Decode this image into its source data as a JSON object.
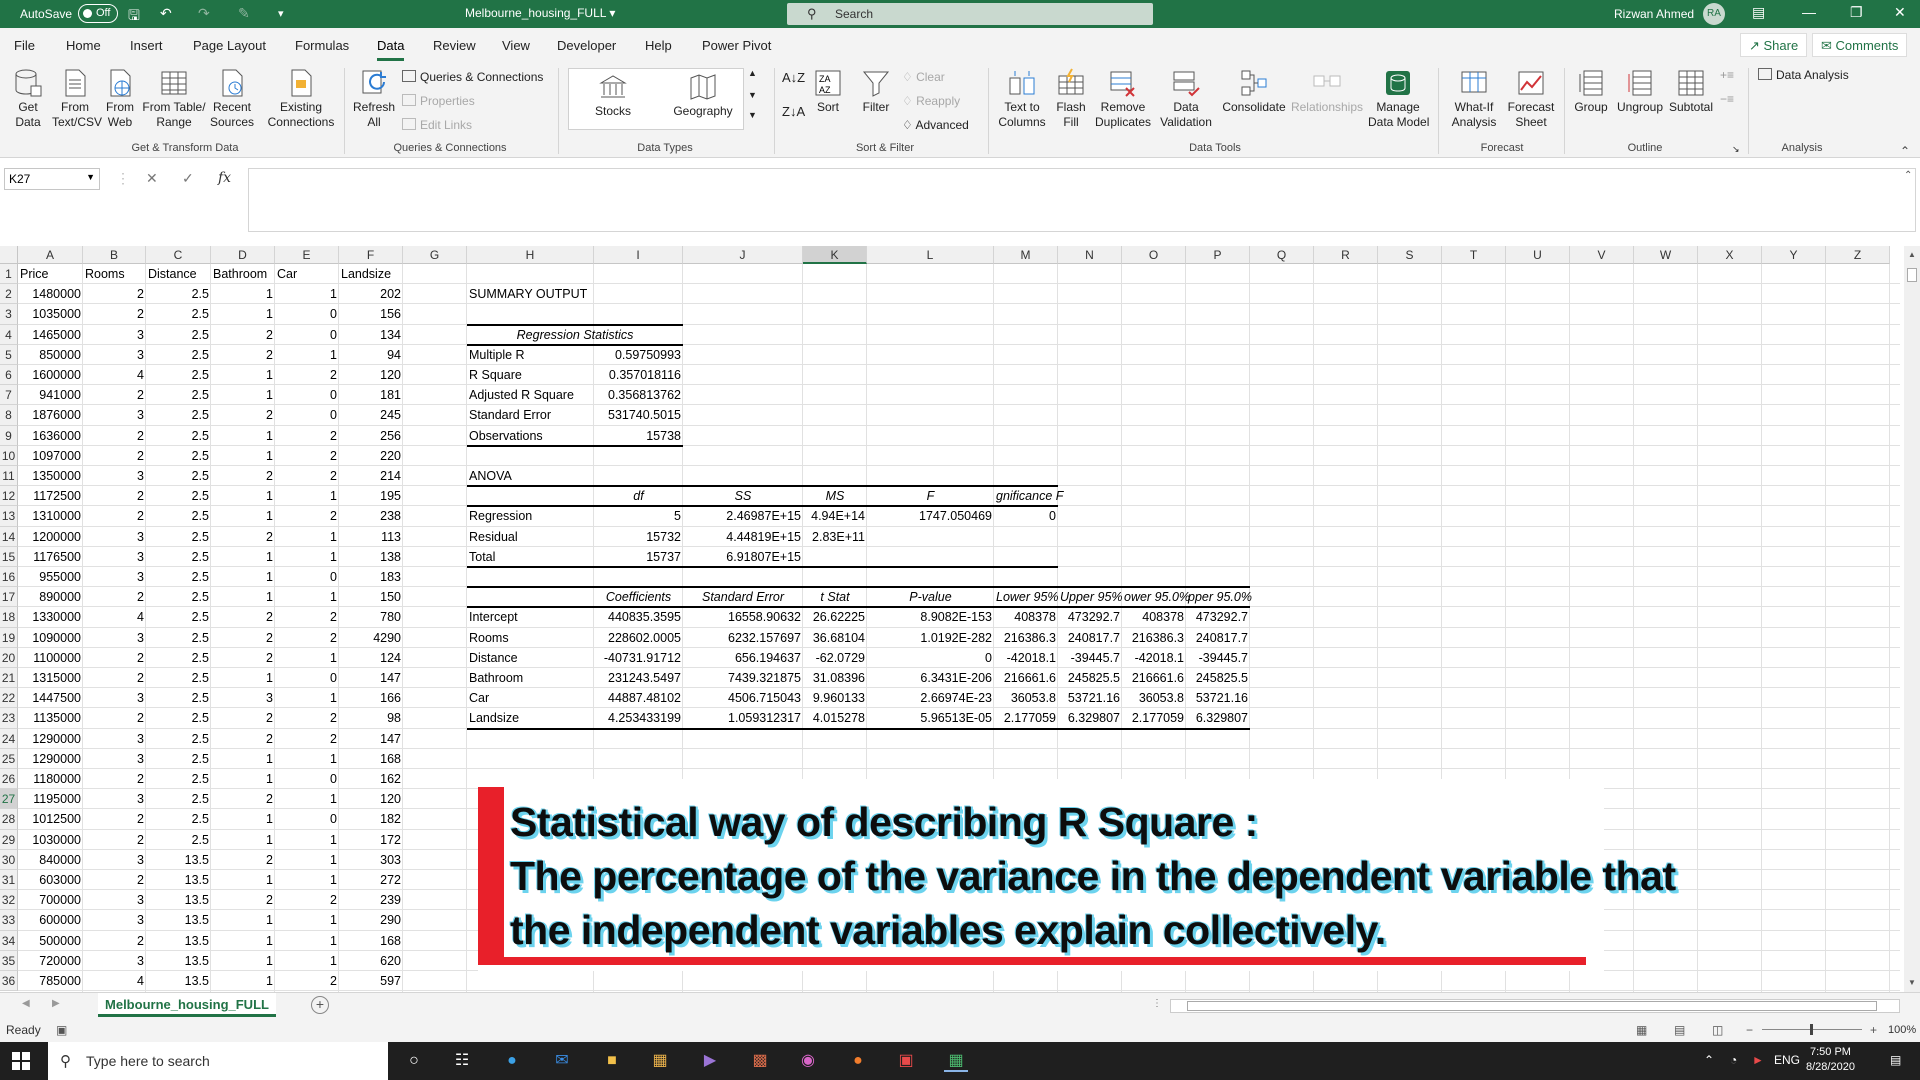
{
  "titlebar": {
    "autosave_label": "AutoSave",
    "autosave_state": "Off",
    "doc_title": "Melbourne_housing_FULL",
    "search_placeholder": "Search",
    "user_name": "Rizwan Ahmed",
    "user_initials": "RA"
  },
  "menu": {
    "tabs": [
      "File",
      "Home",
      "Insert",
      "Page Layout",
      "Formulas",
      "Data",
      "Review",
      "View",
      "Developer",
      "Help",
      "Power Pivot"
    ],
    "active": "Data",
    "share_label": "Share",
    "comments_label": "Comments"
  },
  "ribbon": {
    "get_data": "Get\nData",
    "from_text_csv": "From\nText/CSV",
    "from_web": "From\nWeb",
    "from_table_range": "From Table/\nRange",
    "recent_sources": "Recent\nSources",
    "existing_connections": "Existing\nConnections",
    "group_get_transform": "Get & Transform Data",
    "refresh_all": "Refresh\nAll",
    "queries_connections": "Queries & Connections",
    "properties": "Properties",
    "edit_links": "Edit Links",
    "group_queries": "Queries & Connections",
    "stocks": "Stocks",
    "geography": "Geography",
    "group_data_types": "Data Types",
    "sort": "Sort",
    "filter": "Filter",
    "clear": "Clear",
    "reapply": "Reapply",
    "advanced": "Advanced",
    "group_sort_filter": "Sort & Filter",
    "text_to_columns": "Text to\nColumns",
    "flash_fill": "Flash\nFill",
    "remove_duplicates": "Remove\nDuplicates",
    "data_validation": "Data\nValidation",
    "consolidate": "Consolidate",
    "relationships": "Relationships",
    "manage_data_model": "Manage\nData Model",
    "group_data_tools": "Data Tools",
    "what_if": "What-If\nAnalysis",
    "forecast_sheet": "Forecast\nSheet",
    "group_forecast": "Forecast",
    "group": "Group",
    "ungroup": "Ungroup",
    "subtotal": "Subtotal",
    "group_outline": "Outline",
    "data_analysis": "Data Analysis",
    "group_analysis": "Analysis"
  },
  "formula_bar": {
    "name_box": "K27",
    "fx": "fx",
    "formula": ""
  },
  "grid": {
    "columns": [
      "A",
      "B",
      "C",
      "D",
      "E",
      "F",
      "G",
      "H",
      "I",
      "J",
      "K",
      "L",
      "M",
      "N",
      "O",
      "P",
      "Q",
      "R",
      "S",
      "T",
      "U",
      "V",
      "W",
      "X",
      "Y",
      "Z"
    ],
    "selected_column": "K",
    "selected_row": 27,
    "data_headers": [
      "Price",
      "Rooms",
      "Distance",
      "Bathroom",
      "Car",
      "Landsize"
    ],
    "data_rows": [
      [
        "1480000",
        "2",
        "2.5",
        "1",
        "1",
        "202"
      ],
      [
        "1035000",
        "2",
        "2.5",
        "1",
        "0",
        "156"
      ],
      [
        "1465000",
        "3",
        "2.5",
        "2",
        "0",
        "134"
      ],
      [
        "850000",
        "3",
        "2.5",
        "2",
        "1",
        "94"
      ],
      [
        "1600000",
        "4",
        "2.5",
        "1",
        "2",
        "120"
      ],
      [
        "941000",
        "2",
        "2.5",
        "1",
        "0",
        "181"
      ],
      [
        "1876000",
        "3",
        "2.5",
        "2",
        "0",
        "245"
      ],
      [
        "1636000",
        "2",
        "2.5",
        "1",
        "2",
        "256"
      ],
      [
        "1097000",
        "2",
        "2.5",
        "1",
        "2",
        "220"
      ],
      [
        "1350000",
        "3",
        "2.5",
        "2",
        "2",
        "214"
      ],
      [
        "1172500",
        "2",
        "2.5",
        "1",
        "1",
        "195"
      ],
      [
        "1310000",
        "2",
        "2.5",
        "1",
        "2",
        "238"
      ],
      [
        "1200000",
        "3",
        "2.5",
        "2",
        "1",
        "113"
      ],
      [
        "1176500",
        "3",
        "2.5",
        "1",
        "1",
        "138"
      ],
      [
        "955000",
        "3",
        "2.5",
        "1",
        "0",
        "183"
      ],
      [
        "890000",
        "2",
        "2.5",
        "1",
        "1",
        "150"
      ],
      [
        "1330000",
        "4",
        "2.5",
        "2",
        "2",
        "780"
      ],
      [
        "1090000",
        "3",
        "2.5",
        "2",
        "2",
        "4290"
      ],
      [
        "1100000",
        "2",
        "2.5",
        "2",
        "1",
        "124"
      ],
      [
        "1315000",
        "2",
        "2.5",
        "1",
        "0",
        "147"
      ],
      [
        "1447500",
        "3",
        "2.5",
        "3",
        "1",
        "166"
      ],
      [
        "1135000",
        "2",
        "2.5",
        "2",
        "2",
        "98"
      ],
      [
        "1290000",
        "3",
        "2.5",
        "2",
        "2",
        "147"
      ],
      [
        "1290000",
        "3",
        "2.5",
        "1",
        "1",
        "168"
      ],
      [
        "1180000",
        "2",
        "2.5",
        "1",
        "0",
        "162"
      ],
      [
        "1195000",
        "3",
        "2.5",
        "2",
        "1",
        "120"
      ],
      [
        "1012500",
        "2",
        "2.5",
        "1",
        "0",
        "182"
      ],
      [
        "1030000",
        "2",
        "2.5",
        "1",
        "1",
        "172"
      ],
      [
        "840000",
        "3",
        "13.5",
        "2",
        "1",
        "303"
      ],
      [
        "603000",
        "2",
        "13.5",
        "1",
        "1",
        "272"
      ],
      [
        "700000",
        "3",
        "13.5",
        "2",
        "2",
        "239"
      ],
      [
        "600000",
        "3",
        "13.5",
        "1",
        "1",
        "290"
      ],
      [
        "500000",
        "2",
        "13.5",
        "1",
        "1",
        "168"
      ],
      [
        "720000",
        "3",
        "13.5",
        "1",
        "1",
        "620"
      ],
      [
        "785000",
        "4",
        "13.5",
        "1",
        "2",
        "597"
      ]
    ]
  },
  "summary": {
    "title": "SUMMARY OUTPUT",
    "reg_stats_header": "Regression Statistics",
    "reg_stats": [
      [
        "Multiple R",
        "0.59750993"
      ],
      [
        "R Square",
        "0.357018116"
      ],
      [
        "Adjusted R Square",
        "0.356813762"
      ],
      [
        "Standard Error",
        "531740.5015"
      ],
      [
        "Observations",
        "15738"
      ]
    ],
    "anova_title": "ANOVA",
    "anova_headers": [
      "df",
      "SS",
      "MS",
      "F",
      "gnificance F"
    ],
    "anova_rows": [
      [
        "Regression",
        "5",
        "2.46987E+15",
        "4.94E+14",
        "1747.050469",
        "0"
      ],
      [
        "Residual",
        "15732",
        "4.44819E+15",
        "2.83E+11",
        "",
        ""
      ],
      [
        "Total",
        "15737",
        "6.91807E+15",
        "",
        "",
        ""
      ]
    ],
    "coef_headers": [
      "Coefficients",
      "Standard Error",
      "t Stat",
      "P-value",
      "Lower 95%",
      "Upper 95%",
      "ower 95.0%",
      "pper 95.0%"
    ],
    "coef_rows": [
      [
        "Intercept",
        "440835.3595",
        "16558.90632",
        "26.62225",
        "8.9082E-153",
        "408378",
        "473292.7",
        "408378",
        "473292.7"
      ],
      [
        "Rooms",
        "228602.0005",
        "6232.157697",
        "36.68104",
        "1.0192E-282",
        "216386.3",
        "240817.7",
        "216386.3",
        "240817.7"
      ],
      [
        "Distance",
        "-40731.91712",
        "656.194637",
        "-62.0729",
        "0",
        "-42018.1",
        "-39445.7",
        "-42018.1",
        "-39445.7"
      ],
      [
        "Bathroom",
        "231243.5497",
        "7439.321875",
        "31.08396",
        "6.3431E-206",
        "216661.6",
        "245825.5",
        "216661.6",
        "245825.5"
      ],
      [
        "Car",
        "44887.48102",
        "4506.715043",
        "9.960133",
        "2.66974E-23",
        "36053.8",
        "53721.16",
        "36053.8",
        "53721.16"
      ],
      [
        "Landsize",
        "4.253433199",
        "1.059312317",
        "4.015278",
        "5.96513E-05",
        "2.177059",
        "6.329807",
        "2.177059",
        "6.329807"
      ]
    ]
  },
  "banner": {
    "line1": "Statistical way of describing R Square :",
    "line2": "The percentage of the variance in the dependent variable that",
    "line3": "the independent variables explain collectively."
  },
  "sheets": {
    "tabs": [
      "Melbourne_housing_FULL"
    ],
    "add_symbol": "+"
  },
  "status": {
    "ready": "Ready",
    "zoom": "100%"
  },
  "taskbar": {
    "search_placeholder": "Type here to search",
    "language": "ENG",
    "time": "7:50 PM",
    "date": "8/28/2020"
  },
  "colors": {
    "excel_green": "#217346",
    "banner_red": "#e8202a",
    "banner_glow": "#6cd3ee"
  }
}
